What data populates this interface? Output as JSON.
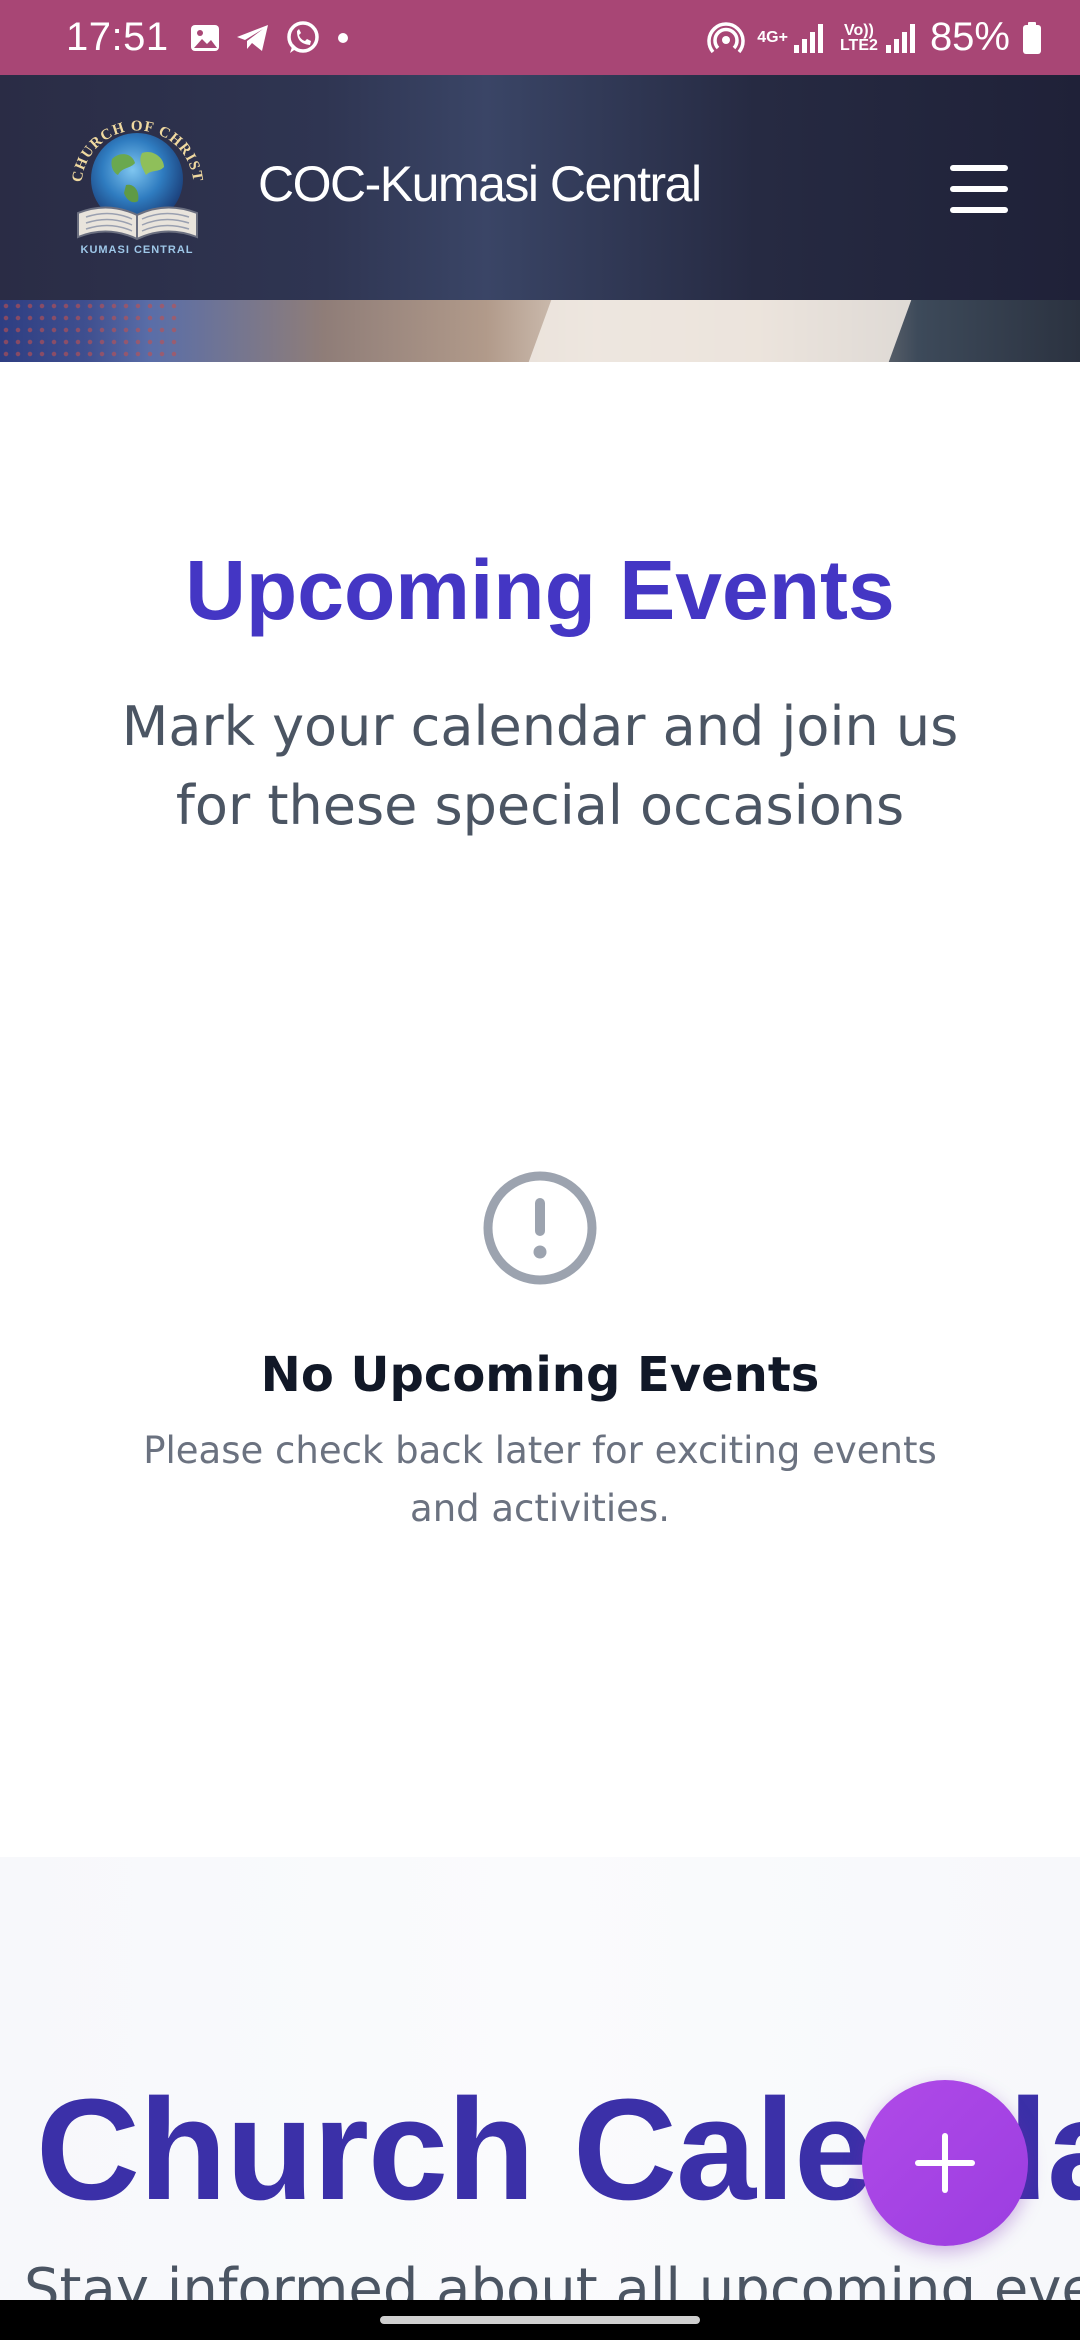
{
  "status_bar": {
    "time": "17:51",
    "battery": "85%",
    "left_icons": [
      "gallery-icon",
      "telegram-icon",
      "whatsapp-icon",
      "dot-icon"
    ],
    "right_icons": [
      "hotspot-icon",
      "4g-signal-icon",
      "volte-lte2-signal-icon",
      "battery-icon"
    ],
    "network_label": "4G+",
    "volte_label": "Vo)) LTE2"
  },
  "header": {
    "logo_text_top": "CHURCH OF CHRIST",
    "logo_text_bottom": "KUMASI CENTRAL",
    "title": "COC-Kumasi Central",
    "menu_icon": "hamburger-menu-icon"
  },
  "events": {
    "title": "Upcoming Events",
    "subtitle": "Mark your calendar and join us for these special occasions",
    "empty_icon": "exclamation-circle-icon",
    "empty_title": "No Upcoming Events",
    "empty_description": "Please check back later for exciting events and activities."
  },
  "calendar": {
    "title": "Church Calendar",
    "subtitle": "Stay informed about all upcoming events"
  },
  "fab": {
    "icon": "plus-icon"
  },
  "colors": {
    "status_bar": "#a84675",
    "accent": "#4436c4",
    "fab": "#a344e6"
  }
}
